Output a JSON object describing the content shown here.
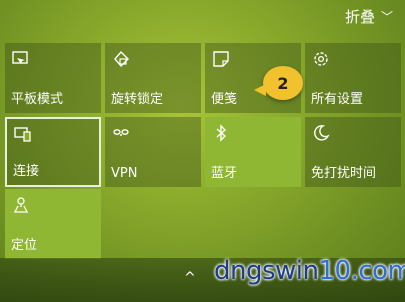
{
  "header": {
    "collapse_label": "折叠",
    "chevron": "﹀"
  },
  "tiles": [
    {
      "label": "平板模式",
      "icon": "tablet-mode-icon",
      "on": false
    },
    {
      "label": "旋转锁定",
      "icon": "rotation-lock-icon",
      "on": false
    },
    {
      "label": "便笺",
      "icon": "note-icon",
      "on": false
    },
    {
      "label": "所有设置",
      "icon": "gear-icon",
      "on": false
    },
    {
      "label": "连接",
      "icon": "connect-icon",
      "on": false,
      "selected": true
    },
    {
      "label": "VPN",
      "icon": "vpn-icon",
      "on": false
    },
    {
      "label": "蓝牙",
      "icon": "bluetooth-icon",
      "on": true
    },
    {
      "label": "免打扰时间",
      "icon": "moon-icon",
      "on": false
    },
    {
      "label": "定位",
      "icon": "location-icon",
      "on": true
    }
  ],
  "callout": {
    "number": "2"
  },
  "footer": {
    "up_arrow": "^"
  },
  "watermark": {
    "part1": "dngswin",
    "part2": "10.com"
  },
  "colors": {
    "tile_on": "#8fb733",
    "badge": "#f2c12e"
  }
}
